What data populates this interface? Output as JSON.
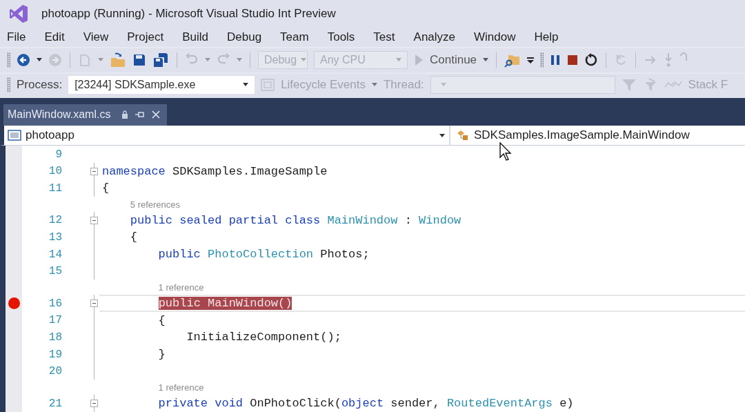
{
  "window": {
    "title": "photoapp (Running) - Microsoft Visual Studio Int Preview"
  },
  "menu": [
    "File",
    "Edit",
    "View",
    "Project",
    "Build",
    "Debug",
    "Team",
    "Tools",
    "Test",
    "Analyze",
    "Window",
    "Help"
  ],
  "standard_toolbar": {
    "configuration": {
      "value": "Debug",
      "disabled": true
    },
    "platform": {
      "value": "Any CPU",
      "disabled": true
    },
    "continue_button": {
      "label": "Continue"
    }
  },
  "debug_location_toolbar": {
    "process_label": "Process:",
    "process": "[23244] SDKSample.exe",
    "lifecycle": {
      "label": "Lifecycle Events",
      "disabled": true
    },
    "thread_label": "Thread:",
    "stack_frame_label": "Stack F"
  },
  "document_tabs": [
    {
      "label": "MainWindow.xaml.cs",
      "selected": true
    }
  ],
  "navigation_bar": {
    "project": "photoapp",
    "type": "SDKSamples.ImageSample.MainWindow"
  },
  "code_lines": [
    {
      "number": "9"
    },
    {
      "number": "10",
      "expanded": true,
      "segments": [
        {
          "kind": "kw",
          "text": "namespace"
        },
        {
          "kind": "plain",
          "text": " SDKSamples.ImageSample"
        }
      ]
    },
    {
      "number": "11",
      "segments": [
        {
          "kind": "plain",
          "text": "{"
        }
      ]
    },
    {
      "number": "12",
      "expanded": true,
      "lens": "5 references",
      "segments": [
        {
          "kind": "kw",
          "text": "    public sealed partial class "
        },
        {
          "kind": "type",
          "text": "MainWindow"
        },
        {
          "kind": "plain",
          "text": " : "
        },
        {
          "kind": "type",
          "text": "Window"
        }
      ]
    },
    {
      "number": "13",
      "segments": [
        {
          "kind": "plain",
          "text": "    {"
        }
      ]
    },
    {
      "number": "14",
      "segments": [
        {
          "kind": "kw",
          "text": "        public "
        },
        {
          "kind": "type",
          "text": "PhotoCollection"
        },
        {
          "kind": "plain",
          "text": " Photos;"
        }
      ]
    },
    {
      "number": "15"
    },
    {
      "number": "16",
      "expanded": true,
      "breakpoint": true,
      "lens": "1 reference",
      "segments": [
        {
          "kind": "breakpoint",
          "text": "        public MainWindow()"
        }
      ]
    },
    {
      "number": "17",
      "segments": [
        {
          "kind": "plain",
          "text": "        {"
        }
      ]
    },
    {
      "number": "18",
      "segments": [
        {
          "kind": "plain",
          "text": "            InitializeComponent();"
        }
      ]
    },
    {
      "number": "19",
      "segments": [
        {
          "kind": "plain",
          "text": "        }"
        }
      ]
    },
    {
      "number": "20"
    },
    {
      "number": "21",
      "expanded": true,
      "lens": "1 reference",
      "segments": [
        {
          "kind": "kw",
          "text": "        private void"
        },
        {
          "kind": "plain",
          "text": " OnPhotoClick("
        },
        {
          "kind": "kw",
          "text": "object"
        },
        {
          "kind": "plain",
          "text": " sender, "
        },
        {
          "kind": "type",
          "text": "RoutedEventArgs"
        },
        {
          "kind": "plain",
          "text": " e)"
        }
      ]
    }
  ]
}
